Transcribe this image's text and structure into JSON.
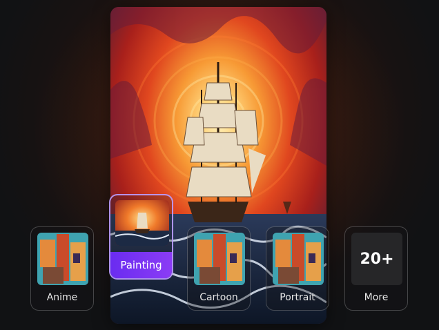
{
  "styles": [
    {
      "label": "Anime",
      "thumb": "building-thumb",
      "active": false
    },
    {
      "label": "Painting",
      "thumb": "ship-thumb",
      "active": true
    },
    {
      "label": "Cartoon",
      "thumb": "building-thumb",
      "active": false
    },
    {
      "label": "Portrait",
      "thumb": "building-thumb",
      "active": false
    }
  ],
  "more": {
    "count": "20+",
    "label": "More"
  },
  "colors": {
    "accent": "#7a34f2",
    "sky_center": "#ffd37a",
    "sky_outer": "#c2271c",
    "sea": "#14243a"
  }
}
